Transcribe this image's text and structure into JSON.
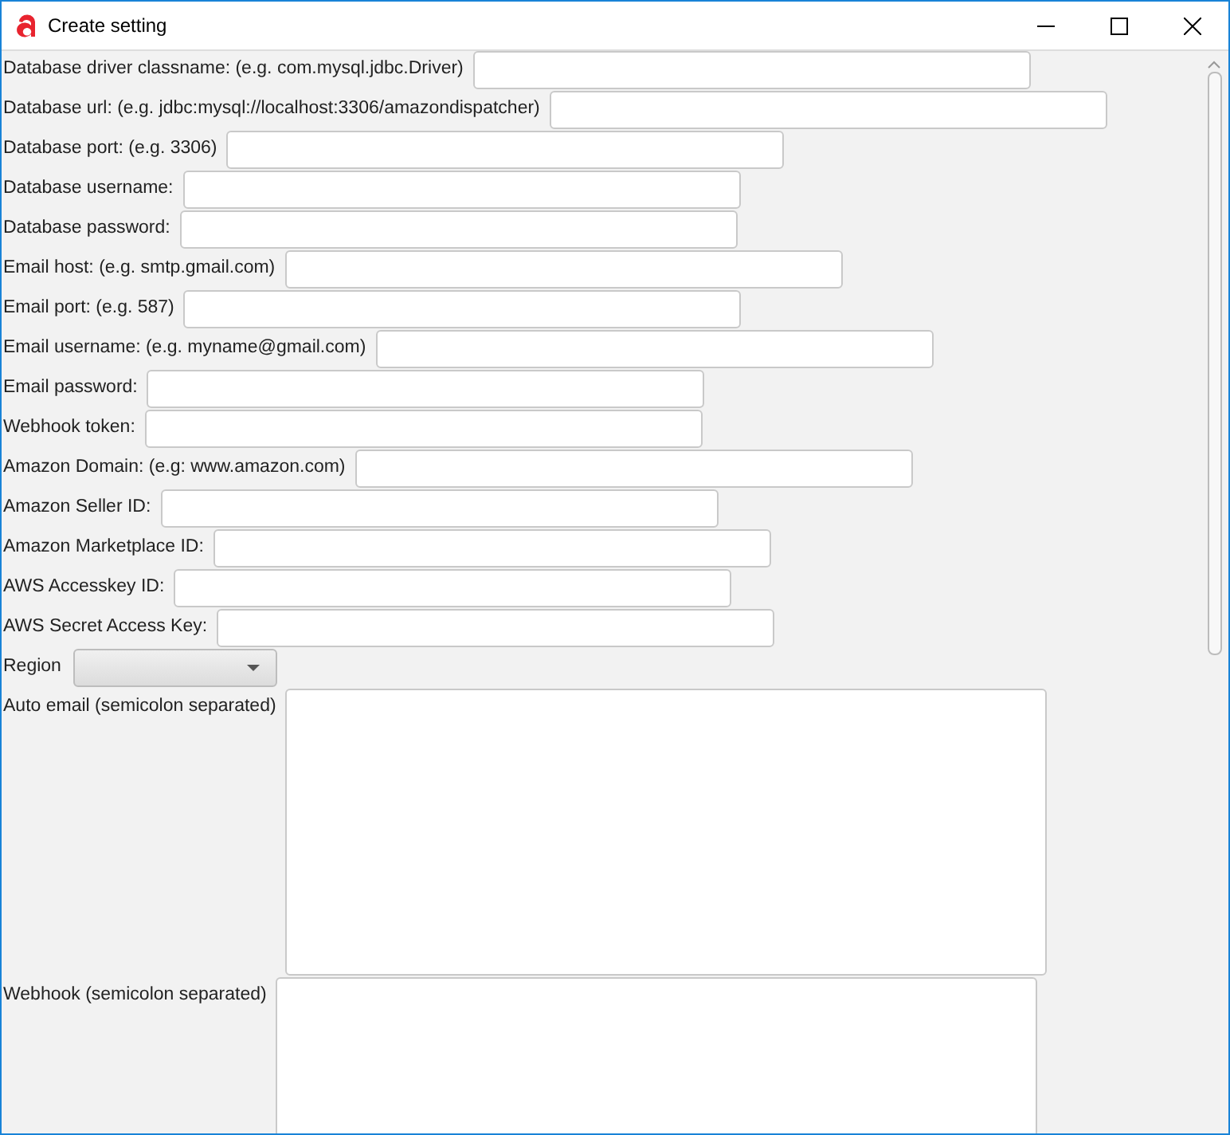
{
  "window": {
    "title": "Create setting"
  },
  "fields": [
    {
      "kind": "text",
      "label": "Database driver classname: (e.g. com.mysql.jdbc.Driver)"
    },
    {
      "kind": "text",
      "label": "Database url: (e.g. jdbc:mysql://localhost:3306/amazondispatcher)"
    },
    {
      "kind": "text",
      "label": "Database port: (e.g. 3306)"
    },
    {
      "kind": "text",
      "label": "Database username:"
    },
    {
      "kind": "text",
      "label": "Database password:"
    },
    {
      "kind": "text",
      "label": "Email host: (e.g. smtp.gmail.com)"
    },
    {
      "kind": "text",
      "label": "Email port: (e.g. 587)"
    },
    {
      "kind": "text",
      "label": "Email username: (e.g. myname@gmail.com)"
    },
    {
      "kind": "text",
      "label": "Email password:"
    },
    {
      "kind": "text",
      "label": "Webhook token:"
    },
    {
      "kind": "text",
      "label": "Amazon Domain: (e.g: www.amazon.com)"
    },
    {
      "kind": "text",
      "label": "Amazon Seller ID:"
    },
    {
      "kind": "text",
      "label": "Amazon Marketplace ID:"
    },
    {
      "kind": "text",
      "label": "AWS Accesskey ID:"
    },
    {
      "kind": "text",
      "label": "AWS Secret Access Key:"
    },
    {
      "kind": "select",
      "label": "Region"
    },
    {
      "kind": "textarea",
      "label": "Auto email (semicolon separated)"
    },
    {
      "kind": "textarea",
      "label": "Webhook (semicolon separated)"
    }
  ]
}
